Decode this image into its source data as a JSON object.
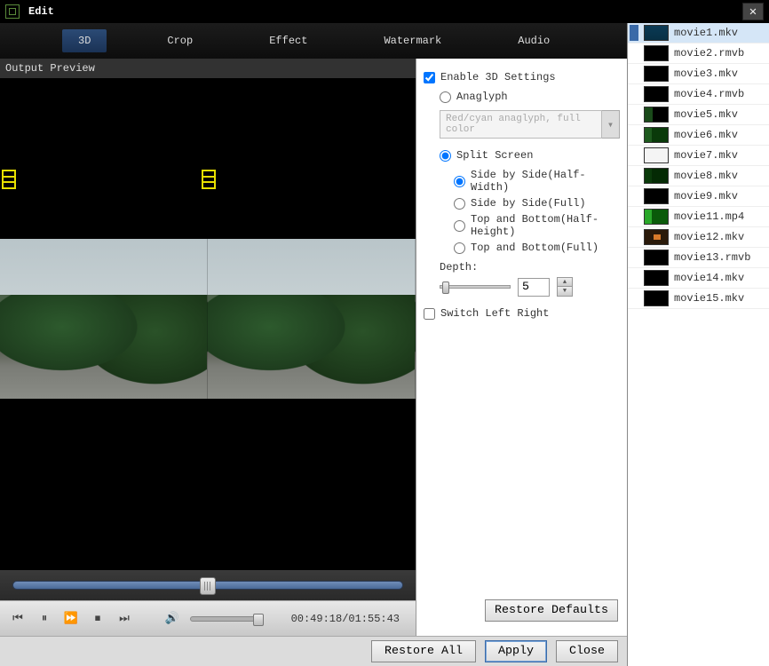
{
  "window": {
    "title": "Edit"
  },
  "tabs": {
    "items": [
      "3D",
      "Crop",
      "Effect",
      "Watermark",
      "Audio"
    ],
    "active_index": 0
  },
  "preview": {
    "label": "Output Preview",
    "timecode": "00:49:18/01:55:43"
  },
  "settings_3d": {
    "enable_label": "Enable 3D Settings",
    "enable_checked": true,
    "anaglyph": {
      "label": "Anaglyph",
      "selected": false,
      "combo_value": "Red/cyan anaglyph, full color"
    },
    "split_screen": {
      "label": "Split Screen",
      "selected": true,
      "options": [
        {
          "label": "Side by Side(Half-Width)",
          "selected": true
        },
        {
          "label": "Side by Side(Full)",
          "selected": false
        },
        {
          "label": "Top and Bottom(Half-Height)",
          "selected": false
        },
        {
          "label": "Top and Bottom(Full)",
          "selected": false
        }
      ]
    },
    "depth": {
      "label": "Depth:",
      "value": "5"
    },
    "switch_lr": {
      "label": "Switch Left Right",
      "checked": false
    },
    "restore_label": "Restore Defaults"
  },
  "footer": {
    "restore_all": "Restore All",
    "apply": "Apply",
    "close": "Close"
  },
  "files": [
    {
      "name": "movie1.mkv",
      "thumb": "t-teal",
      "selected": true
    },
    {
      "name": "movie2.rmvb",
      "thumb": "",
      "selected": false
    },
    {
      "name": "movie3.mkv",
      "thumb": "",
      "selected": false
    },
    {
      "name": "movie4.rmvb",
      "thumb": "",
      "selected": false
    },
    {
      "name": "movie5.mkv",
      "thumb": "t-green",
      "selected": false
    },
    {
      "name": "movie6.mkv",
      "thumb": "t-green2",
      "selected": false
    },
    {
      "name": "movie7.mkv",
      "thumb": "t-white",
      "selected": false
    },
    {
      "name": "movie8.mkv",
      "thumb": "t-dg",
      "selected": false
    },
    {
      "name": "movie9.mkv",
      "thumb": "",
      "selected": false
    },
    {
      "name": "movie11.mp4",
      "thumb": "t-lg",
      "selected": false
    },
    {
      "name": "movie12.mkv",
      "thumb": "t-or",
      "selected": false
    },
    {
      "name": "movie13.rmvb",
      "thumb": "",
      "selected": false
    },
    {
      "name": "movie14.mkv",
      "thumb": "",
      "selected": false
    },
    {
      "name": "movie15.mkv",
      "thumb": "",
      "selected": false
    }
  ]
}
